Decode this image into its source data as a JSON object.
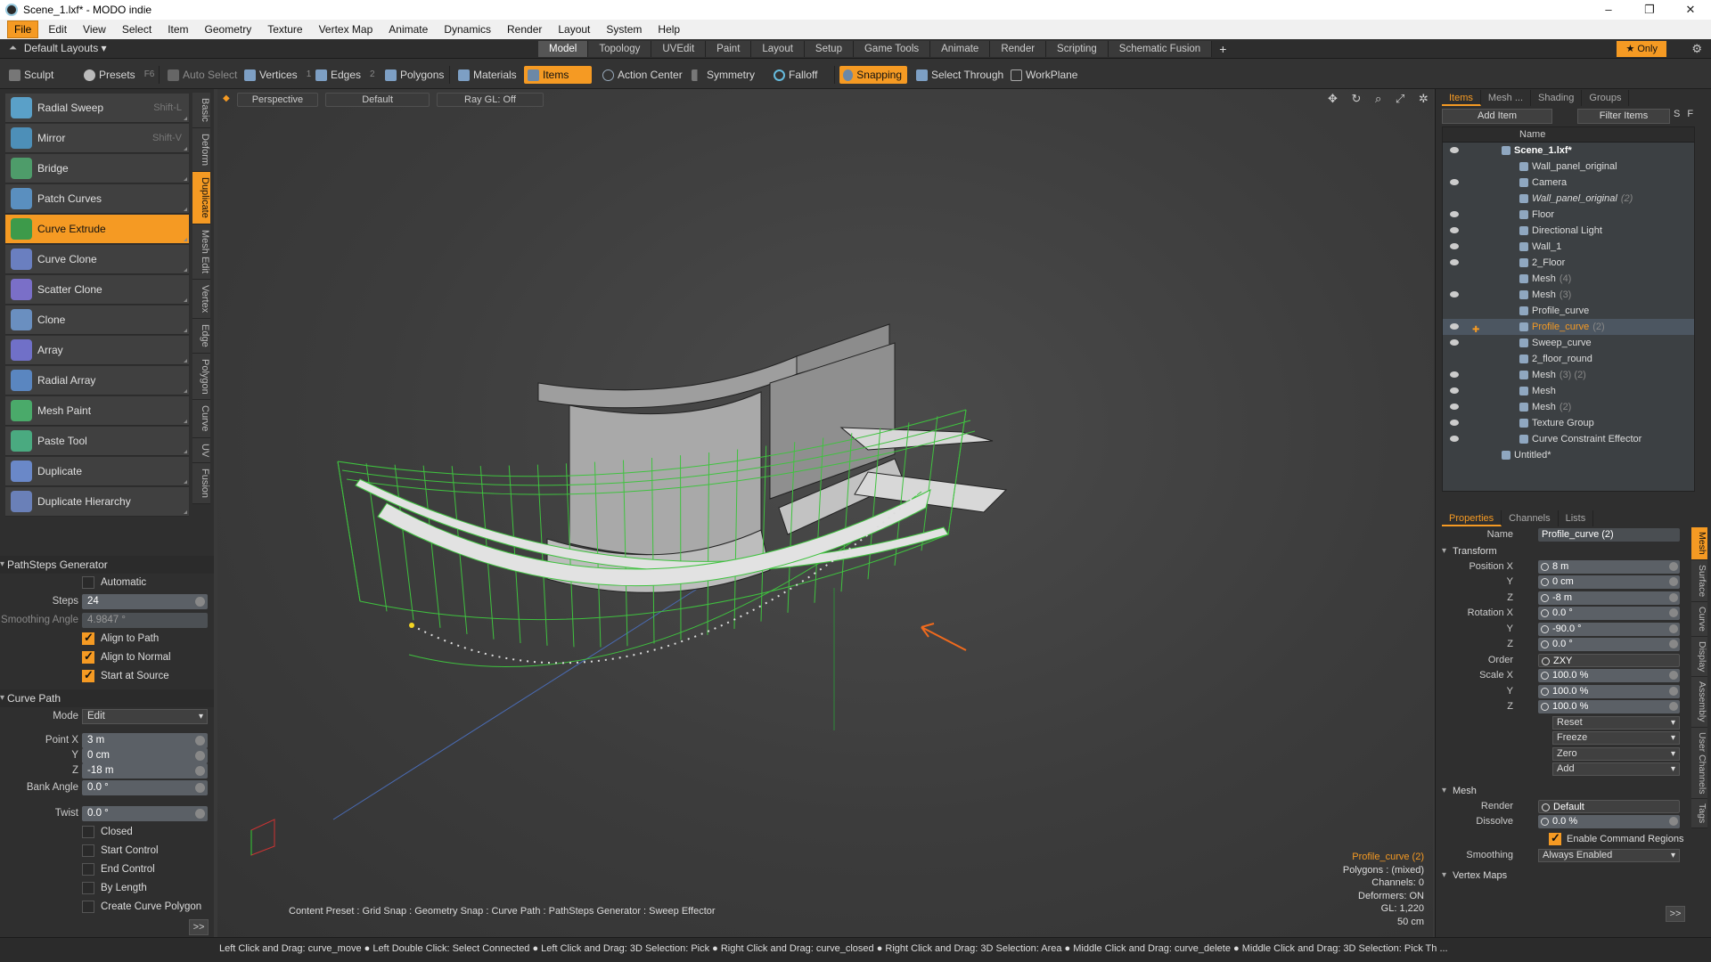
{
  "window": {
    "title": "Scene_1.lxf* - MODO indie",
    "minimize": "–",
    "maximize": "❐",
    "close": "✕"
  },
  "menu": [
    "File",
    "Edit",
    "View",
    "Select",
    "Item",
    "Geometry",
    "Texture",
    "Vertex Map",
    "Animate",
    "Dynamics",
    "Render",
    "Layout",
    "System",
    "Help"
  ],
  "tabbar": {
    "layouts": "Default Layouts ▾",
    "tabs": [
      "Model",
      "Topology",
      "UVEdit",
      "Paint",
      "Layout",
      "Setup",
      "Game Tools",
      "Animate",
      "Render",
      "Scripting",
      "Schematic Fusion"
    ],
    "active_tab": "Model",
    "plus": "+",
    "only": "★  Only"
  },
  "toolbar": {
    "sculpt": "Sculpt",
    "presets": "Presets",
    "presets_key": "F6",
    "auto_select": "Auto Select",
    "vertices": "Vertices",
    "vertices_key": "1",
    "edges": "Edges",
    "edges_key": "2",
    "polygons": "Polygons",
    "materials": "Materials",
    "items": "Items",
    "action_center": "Action Center",
    "symmetry": "Symmetry",
    "falloff": "Falloff",
    "snapping": "Snapping",
    "select_through": "Select Through",
    "workplane": "WorkPlane"
  },
  "tools": [
    {
      "label": "Radial Sweep",
      "shortcut": "Shift-L"
    },
    {
      "label": "Mirror",
      "shortcut": "Shift-V"
    },
    {
      "label": "Bridge",
      "shortcut": ""
    },
    {
      "label": "Patch Curves",
      "shortcut": ""
    },
    {
      "label": "Curve Extrude",
      "shortcut": ""
    },
    {
      "label": "Curve Clone",
      "shortcut": ""
    },
    {
      "label": "Scatter Clone",
      "shortcut": ""
    },
    {
      "label": "Clone",
      "shortcut": ""
    },
    {
      "label": "Array",
      "shortcut": ""
    },
    {
      "label": "Radial Array",
      "shortcut": ""
    },
    {
      "label": "Mesh Paint",
      "shortcut": ""
    },
    {
      "label": "Paste Tool",
      "shortcut": ""
    },
    {
      "label": "Duplicate",
      "shortcut": ""
    },
    {
      "label": "Duplicate Hierarchy",
      "shortcut": ""
    }
  ],
  "selected_tool": "Curve Extrude",
  "vtabs": [
    "Basic",
    "Deform",
    "Duplicate",
    "Mesh Edit",
    "Vertex",
    "Edge",
    "Polygon",
    "Curve",
    "UV",
    "Fusion"
  ],
  "active_vtab": "Duplicate",
  "tool_props": {
    "section1": "PathSteps Generator",
    "automatic": "Automatic",
    "steps_label": "Steps",
    "steps": "24",
    "smoothing_label": "Smoothing Angle",
    "smoothing": "4.9847 °",
    "align_path": "Align to Path",
    "align_normal": "Align to Normal",
    "start_source": "Start at Source",
    "section2": "Curve Path",
    "mode_label": "Mode",
    "mode": "Edit",
    "pointx_label": "Point X",
    "pointx": "3 m",
    "y_label": "Y",
    "pointy": "0 cm",
    "z_label": "Z",
    "pointz": "-18 m",
    "bank_label": "Bank Angle",
    "bank": "0.0 °",
    "twist_label": "Twist",
    "twist": "0.0 °",
    "closed": "Closed",
    "start_control": "Start Control",
    "end_control": "End Control",
    "by_length": "By Length",
    "create_poly": "Create Curve Polygon",
    "more": ">>"
  },
  "viewport": {
    "mode": "Perspective",
    "shading": "Default",
    "raygl": "Ray GL: Off",
    "icons": "✥ ↻ ⌕ ⤢ ✲ ▸",
    "status": "Content Preset : Grid Snap : Geometry Snap : Curve Path : PathSteps Generator : Sweep Effector",
    "info_name": "Profile_curve (2)",
    "info_lines": [
      "Polygons : (mixed)",
      "Channels: 0",
      "Deformers: ON",
      "GL: 1,220",
      "50 cm"
    ]
  },
  "hint": "Left Click and Drag: curve_move ● Left Double Click: Select Connected ● Left Click and Drag: 3D Selection: Pick ● Right Click and Drag: curve_closed ● Right Click and Drag: 3D Selection: Area ● Middle Click and Drag: curve_delete ● Middle Click and Drag: 3D Selection: Pick Th ...",
  "items_panel": {
    "tabs": [
      "Items",
      "Mesh ...",
      "Shading",
      "Groups"
    ],
    "add_item": "Add Item",
    "filter_items": "Filter Items",
    "s": "S",
    "f": "F",
    "col_name": "Name",
    "rows": [
      {
        "name": "Scene_1.lxf*",
        "sub": "",
        "indent": 0,
        "eye": true
      },
      {
        "name": "Wall_panel_original",
        "sub": "",
        "indent": 1,
        "eye": false
      },
      {
        "name": "Camera",
        "sub": "",
        "indent": 1,
        "eye": true
      },
      {
        "name": "Wall_panel_original",
        "sub": "(2)",
        "indent": 1,
        "eye": false
      },
      {
        "name": "Floor",
        "sub": "",
        "indent": 1,
        "eye": true
      },
      {
        "name": "Directional Light",
        "sub": "",
        "indent": 1,
        "eye": true
      },
      {
        "name": "Wall_1",
        "sub": "",
        "indent": 1,
        "eye": true
      },
      {
        "name": "2_Floor",
        "sub": "",
        "indent": 1,
        "eye": true
      },
      {
        "name": "Mesh",
        "sub": "(4)",
        "indent": 1,
        "eye": false
      },
      {
        "name": "Mesh",
        "sub": "(3)",
        "indent": 1,
        "eye": true
      },
      {
        "name": "Profile_curve",
        "sub": "",
        "indent": 1,
        "eye": false
      },
      {
        "name": "Profile_curve",
        "sub": "(2)",
        "indent": 1,
        "eye": true
      },
      {
        "name": "Sweep_curve",
        "sub": "",
        "indent": 1,
        "eye": true
      },
      {
        "name": "2_floor_round",
        "sub": "",
        "indent": 1,
        "eye": false
      },
      {
        "name": "Mesh",
        "sub": "(3) (2)",
        "indent": 1,
        "eye": true
      },
      {
        "name": "Mesh",
        "sub": "",
        "indent": 1,
        "eye": true
      },
      {
        "name": "Mesh",
        "sub": "(2)",
        "indent": 1,
        "eye": true
      },
      {
        "name": "Texture Group",
        "sub": "",
        "indent": 1,
        "eye": true
      },
      {
        "name": "Curve Constraint Effector",
        "sub": "",
        "indent": 1,
        "eye": true
      },
      {
        "name": "Untitled*",
        "sub": "",
        "indent": 0,
        "eye": false
      }
    ]
  },
  "properties": {
    "tabs": [
      "Properties",
      "Channels",
      "Lists"
    ],
    "name_label": "Name",
    "name": "Profile_curve (2)",
    "transform": "Transform",
    "posx_label": "Position X",
    "posx": "8 m",
    "posy_label": "Y",
    "posy": "0 cm",
    "posz_label": "Z",
    "posz": "-8 m",
    "rotx_label": "Rotation X",
    "rotx": "0.0 °",
    "roty_label": "Y",
    "roty": "-90.0 °",
    "rotz_label": "Z",
    "rotz": "0.0 °",
    "order_label": "Order",
    "order": "ZXY",
    "scalex_label": "Scale X",
    "scalex": "100.0 %",
    "scaley_label": "Y",
    "scaley": "100.0 %",
    "scalez_label": "Z",
    "scalez": "100.0 %",
    "reset": "Reset",
    "freeze": "Freeze",
    "zero": "Zero",
    "add": "Add",
    "mesh": "Mesh",
    "render_label": "Render",
    "render": "Default",
    "dissolve_label": "Dissolve",
    "dissolve": "0.0 %",
    "enable_cmd": "Enable Command Regions",
    "smoothing_label": "Smoothing",
    "smoothing": "Always Enabled",
    "vertex_maps": "Vertex Maps",
    "more": ">>"
  },
  "rvtabs": [
    "Mesh",
    "Surface",
    "Curve",
    "Display",
    "Assembly",
    "User Channels",
    "Tags"
  ],
  "active_rvtab": "Mesh",
  "colors": {
    "accent": "#f59a23",
    "wire": "#3fc23f"
  }
}
